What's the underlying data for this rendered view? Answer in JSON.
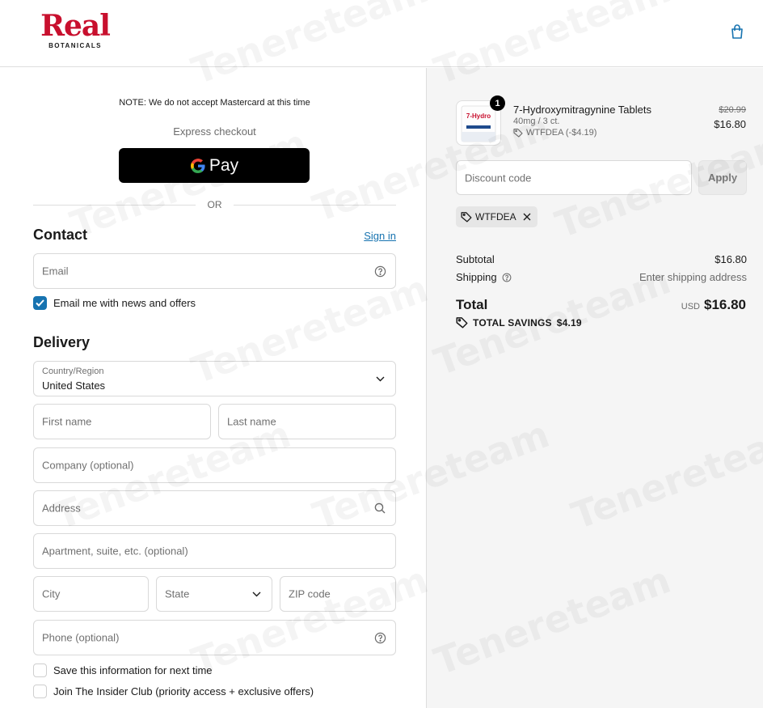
{
  "brand": {
    "name": "Real",
    "sub": "BOTANICALS"
  },
  "notice": "NOTE: We do not accept Mastercard at this time",
  "express": {
    "label": "Express checkout",
    "gpay_label": "Pay"
  },
  "divider": "OR",
  "contact": {
    "heading": "Contact",
    "sign_in": "Sign in",
    "email_placeholder": "Email",
    "newsletter_label": "Email me with news and offers",
    "newsletter_checked": true
  },
  "delivery": {
    "heading": "Delivery",
    "country_label": "Country/Region",
    "country_value": "United States",
    "first_name": "First name",
    "last_name": "Last name",
    "company": "Company (optional)",
    "address": "Address",
    "apartment": "Apartment, suite, etc. (optional)",
    "city": "City",
    "state": "State",
    "zip": "ZIP code",
    "phone": "Phone (optional)",
    "save_info": "Save this information for next time",
    "insider_club": "Join The Insider Club (priority access + exclusive offers)"
  },
  "order": {
    "product": {
      "name": "7-Hydroxymitragynine Tablets",
      "variant": "40mg / 3 ct.",
      "discount": "WTFDEA (-$4.19)",
      "quantity": "1",
      "original_price": "$20.99",
      "price": "$16.80",
      "thumb_text": "7-Hydro"
    },
    "discount_placeholder": "Discount code",
    "apply_label": "Apply",
    "applied_code": "WTFDEA",
    "subtotal_label": "Subtotal",
    "subtotal_value": "$16.80",
    "shipping_label": "Shipping",
    "shipping_value": "Enter shipping address",
    "total_label": "Total",
    "currency": "USD",
    "total_value": "$16.80",
    "savings_label": "TOTAL SAVINGS",
    "savings_value": "$4.19"
  },
  "watermark": "Tenereteam",
  "colors": {
    "brand_red": "#c8102e",
    "link_blue": "#1773b0",
    "panel_gray": "#f5f5f5"
  }
}
